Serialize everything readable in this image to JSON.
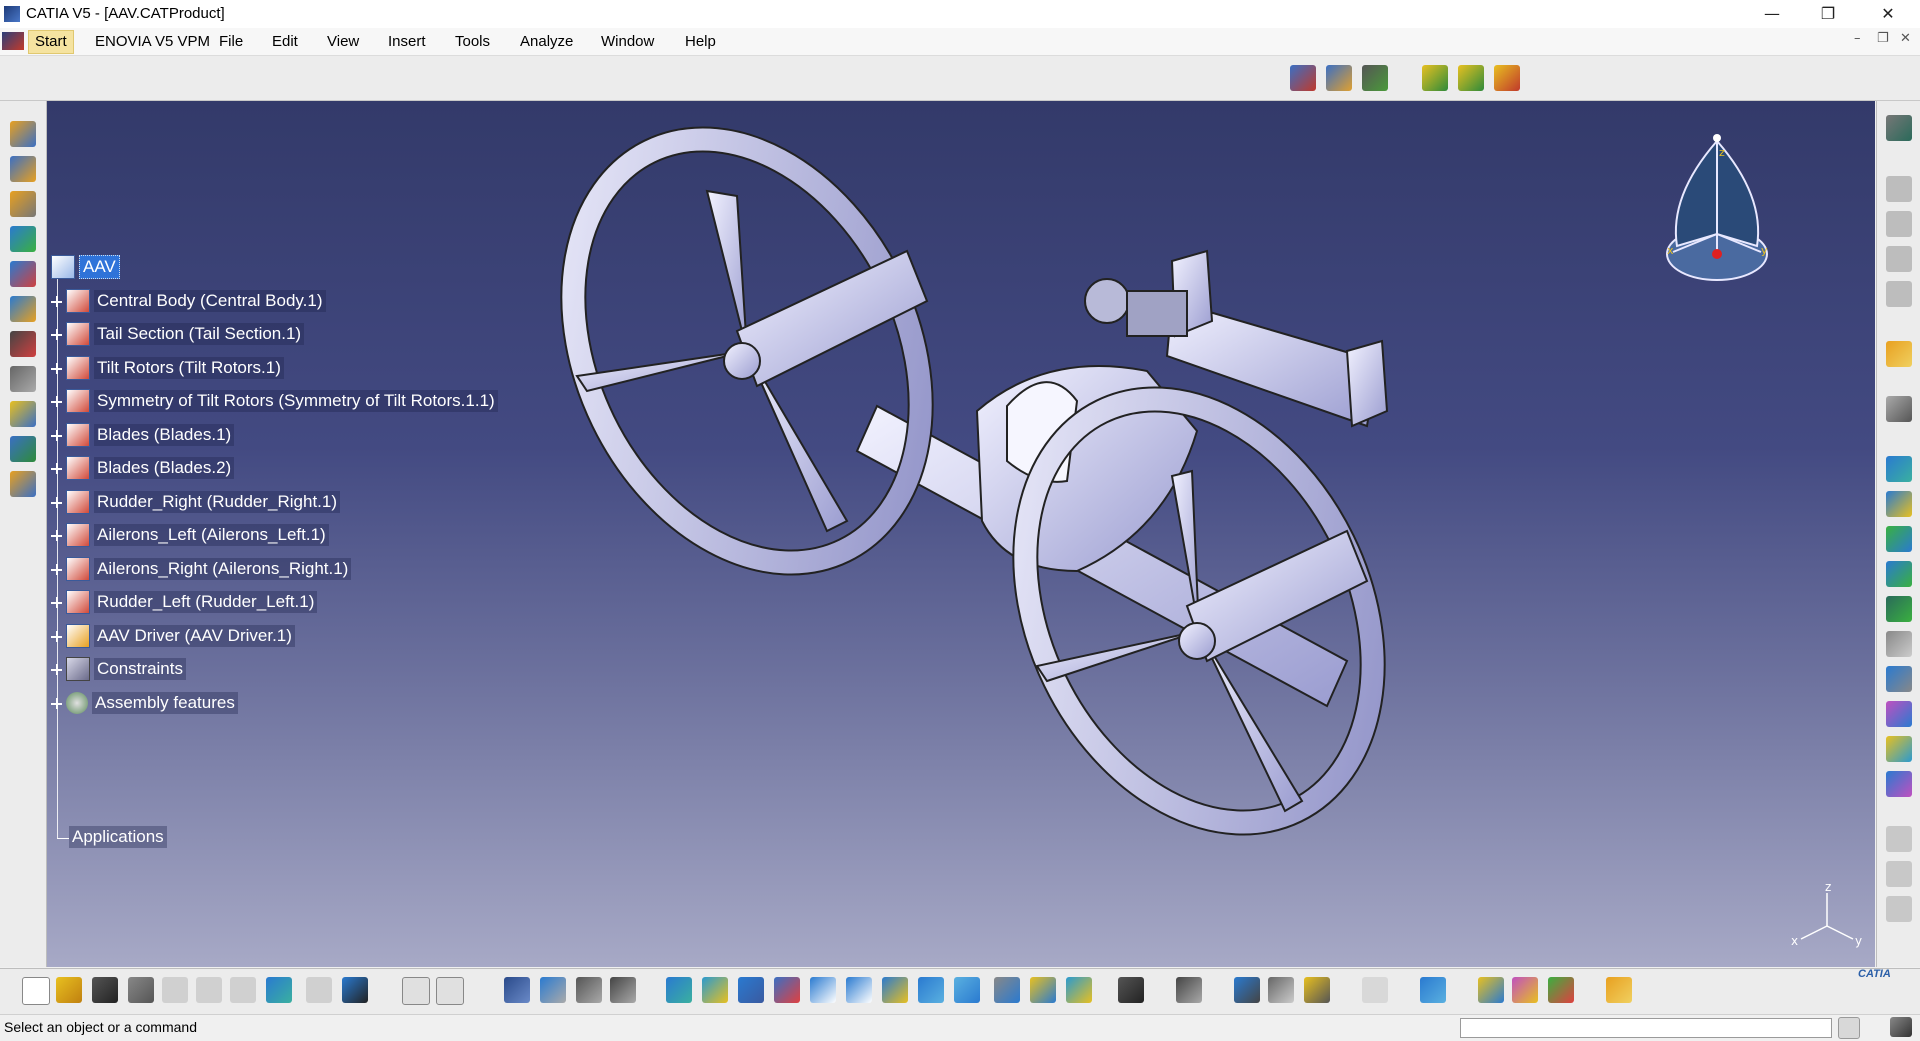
{
  "window": {
    "title": "CATIA V5 - [AAV.CATProduct]"
  },
  "menu": {
    "start": "Start",
    "items": [
      "ENOVIA V5 VPM",
      "File",
      "Edit",
      "View",
      "Insert",
      "Tools",
      "Analyze",
      "Window",
      "Help"
    ]
  },
  "tree": {
    "root": "AAV",
    "children": [
      "Central Body (Central Body.1)",
      "Tail Section (Tail Section.1)",
      "Tilt Rotors (Tilt Rotors.1)",
      "Symmetry of Tilt Rotors (Symmetry of Tilt Rotors.1.1)",
      "Blades (Blades.1)",
      "Blades (Blades.2)",
      "Rudder_Right (Rudder_Right.1)",
      "Ailerons_Left (Ailerons_Left.1)",
      "Ailerons_Right (Ailerons_Right.1)",
      "Rudder_Left (Rudder_Left.1)",
      "AAV Driver (AAV Driver.1)",
      "Constraints",
      "Assembly features"
    ],
    "applications": "Applications"
  },
  "compass": {
    "x": "x",
    "y": "y",
    "z": "z"
  },
  "triad": {
    "x": "x",
    "y": "y",
    "z": "z"
  },
  "status": {
    "message": "Select an object or a command"
  },
  "brand": "CATIA",
  "colors": {
    "viewport_top": "#333a6a",
    "viewport_bottom": "#a7a9c6",
    "selection": "#2f73d9",
    "model": "#c8c9ec"
  }
}
